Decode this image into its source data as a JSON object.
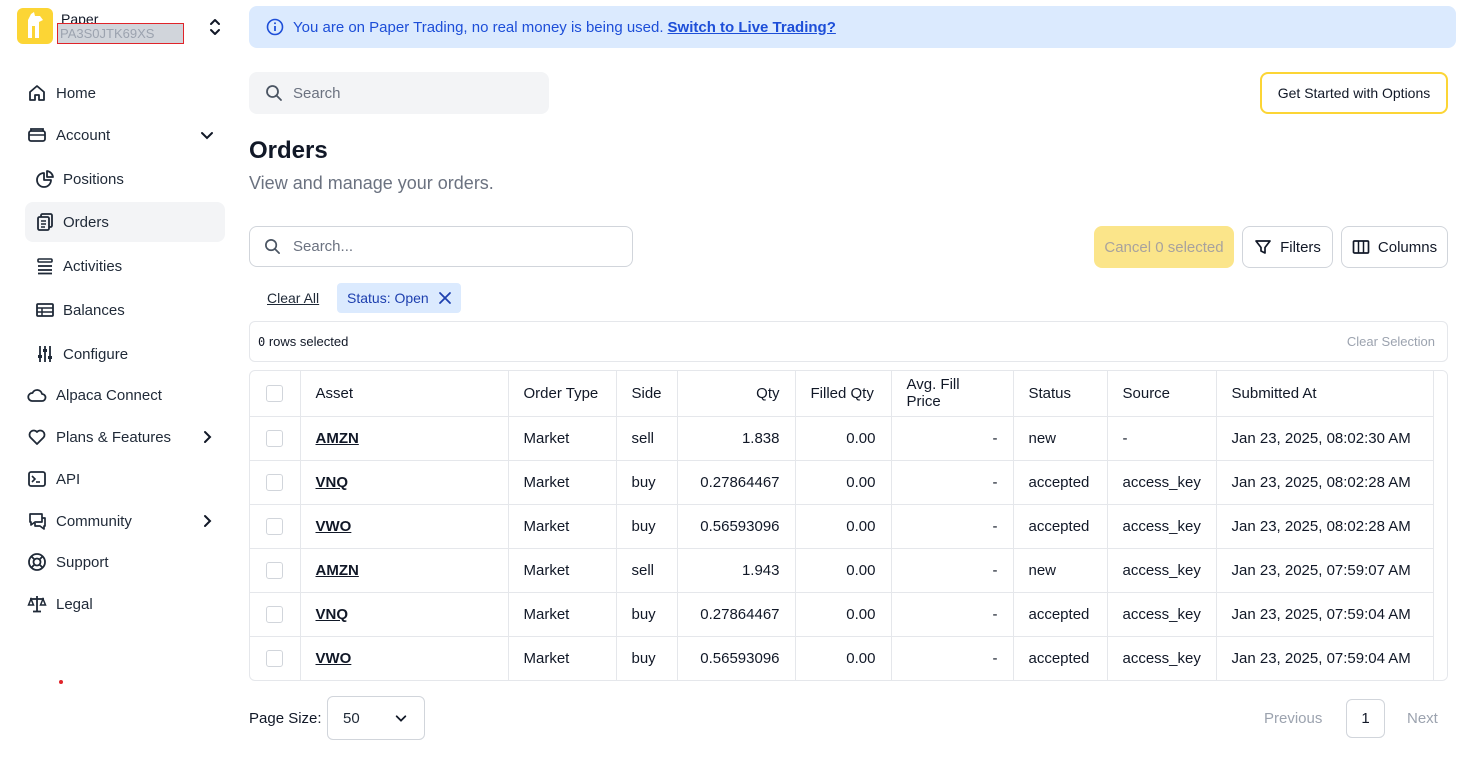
{
  "account": {
    "type": "Paper",
    "id_redacted": "PA3S0JTK69XS"
  },
  "nav": {
    "home": "Home",
    "account": "Account",
    "positions": "Positions",
    "orders": "Orders",
    "activities": "Activities",
    "balances": "Balances",
    "configure": "Configure",
    "alpaca_connect": "Alpaca Connect",
    "plans": "Plans & Features",
    "api": "API",
    "community": "Community",
    "support": "Support",
    "legal": "Legal"
  },
  "banner": {
    "text": "You are on Paper Trading, no real money is being used.",
    "link": "Switch to Live Trading?"
  },
  "top_search": {
    "placeholder": "Search"
  },
  "options_button": "Get Started with Options",
  "page": {
    "title": "Orders",
    "subtitle": "View and manage your orders."
  },
  "table_search": {
    "placeholder": "Search..."
  },
  "actions": {
    "cancel": "Cancel 0 selected",
    "filters": "Filters",
    "columns": "Columns"
  },
  "filters": {
    "clear_all": "Clear All",
    "chip": "Status: Open"
  },
  "selection": {
    "count": "0",
    "text": " rows selected",
    "clear": "Clear Selection"
  },
  "table": {
    "headers": [
      "Asset",
      "Order Type",
      "Side",
      "Qty",
      "Filled Qty",
      "Avg. Fill Price",
      "Status",
      "Source",
      "Submitted At"
    ],
    "rows": [
      {
        "asset": "AMZN",
        "type": "Market",
        "side": "sell",
        "qty": "1.838",
        "filled": "0.00",
        "avg": "-",
        "status": "new",
        "source": "-",
        "submitted": "Jan 23, 2025, 08:02:30 AM"
      },
      {
        "asset": "VNQ",
        "type": "Market",
        "side": "buy",
        "qty": "0.27864467",
        "filled": "0.00",
        "avg": "-",
        "status": "accepted",
        "source": "access_key",
        "submitted": "Jan 23, 2025, 08:02:28 AM"
      },
      {
        "asset": "VWO",
        "type": "Market",
        "side": "buy",
        "qty": "0.56593096",
        "filled": "0.00",
        "avg": "-",
        "status": "accepted",
        "source": "access_key",
        "submitted": "Jan 23, 2025, 08:02:28 AM"
      },
      {
        "asset": "AMZN",
        "type": "Market",
        "side": "sell",
        "qty": "1.943",
        "filled": "0.00",
        "avg": "-",
        "status": "new",
        "source": "access_key",
        "submitted": "Jan 23, 2025, 07:59:07 AM"
      },
      {
        "asset": "VNQ",
        "type": "Market",
        "side": "buy",
        "qty": "0.27864467",
        "filled": "0.00",
        "avg": "-",
        "status": "accepted",
        "source": "access_key",
        "submitted": "Jan 23, 2025, 07:59:04 AM"
      },
      {
        "asset": "VWO",
        "type": "Market",
        "side": "buy",
        "qty": "0.56593096",
        "filled": "0.00",
        "avg": "-",
        "status": "accepted",
        "source": "access_key",
        "submitted": "Jan 23, 2025, 07:59:04 AM"
      }
    ]
  },
  "pagination": {
    "label": "Page Size:",
    "size": "50",
    "previous": "Previous",
    "current": "1",
    "next": "Next"
  },
  "colors": {
    "brand_yellow": "#fcd535",
    "banner_bg": "#dbeafe",
    "banner_text": "#1d4ed8"
  }
}
